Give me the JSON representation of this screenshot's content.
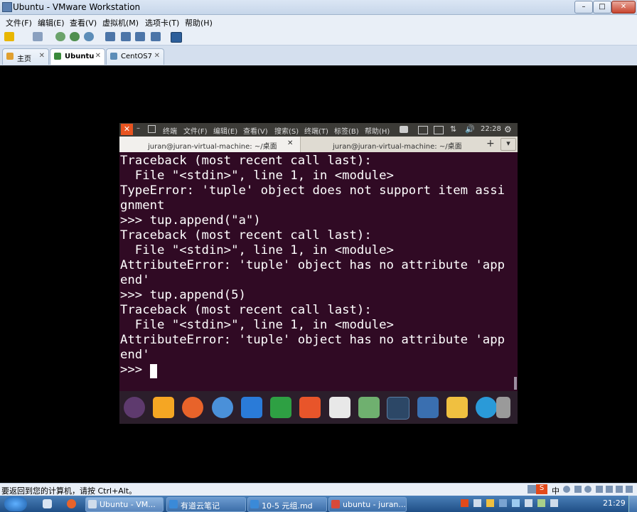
{
  "window": {
    "title": "Ubuntu - VMware Workstation",
    "minimize": "–",
    "maximize": "□",
    "close": "✕"
  },
  "menu": [
    "文件(F)",
    "编辑(E)",
    "查看(V)",
    "虚拟机(M)",
    "选项卡(T)",
    "帮助(H)"
  ],
  "vm_tabs": [
    {
      "label": "主页",
      "close": "✕"
    },
    {
      "label": "Ubuntu",
      "close": "✕"
    },
    {
      "label": "CentOS7",
      "close": "✕"
    }
  ],
  "ubuntu_panel": {
    "app": "终端",
    "menus": [
      "文件(F)",
      "编辑(E)",
      "查看(V)",
      "搜索(S)",
      "终端(T)",
      "标签(B)",
      "帮助(H)"
    ],
    "clock": "22:28"
  },
  "terminal_tabs": [
    {
      "title": "juran@juran-virtual-machine: ~/桌面",
      "close": "✕"
    },
    {
      "title": "juran@juran-virtual-machine: ~/桌面"
    }
  ],
  "terminal_tab_add": "+",
  "terminal_tab_menu": "▾",
  "terminal_lines": [
    "Traceback (most recent call last):",
    "  File \"<stdin>\", line 1, in <module>",
    "TypeError: 'tuple' object does not support item assi",
    "gnment",
    ">>> tup.append(\"a\")",
    "Traceback (most recent call last):",
    "  File \"<stdin>\", line 1, in <module>",
    "AttributeError: 'tuple' object has no attribute 'app",
    "end'",
    ">>> tup.append(5)",
    "Traceback (most recent call last):",
    "  File \"<stdin>\", line 1, in <module>",
    "AttributeError: 'tuple' object has no attribute 'app",
    "end'",
    ">>> "
  ],
  "dock_apps": [
    "ubuntu-logo-icon",
    "files-icon",
    "firefox-icon",
    "chromium-icon",
    "writer-icon",
    "calc-icon",
    "impress-icon",
    "software-center-icon",
    "system-settings-icon",
    "terminal-icon",
    "workspace-switcher-icon",
    "save-icon",
    "dvd-icon",
    "trash-icon"
  ],
  "statusbar": {
    "hint": "要返回到您的计算机，请按 Ctrl+Alt。"
  },
  "taskbar": {
    "items": [
      "Ubuntu - VM...",
      "有道云笔记",
      "10-5 元组.md",
      "ubuntu - juran..."
    ],
    "clock": "21:29",
    "ime": "中"
  },
  "colors": {
    "terminal_bg": "#300a24",
    "ubuntu_panel": "#3c3b37",
    "ubuntu_close": "#e95420"
  }
}
